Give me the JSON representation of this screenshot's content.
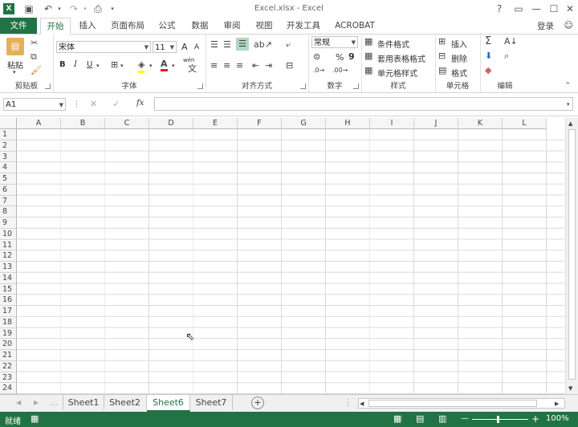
{
  "titlebar": {
    "title": "Excel.xlsx - Excel",
    "help": "?",
    "restore_ribbon": "▭",
    "minimize": "—",
    "maximize": "☐",
    "close": "✕"
  },
  "tabs": {
    "file": "文件",
    "items": [
      "开始",
      "插入",
      "页面布局",
      "公式",
      "数据",
      "审阅",
      "视图",
      "开发工具",
      "ACROBAT"
    ],
    "login": "登录"
  },
  "ribbon": {
    "clipboard": {
      "paste": "粘贴",
      "label": "剪贴板"
    },
    "font": {
      "name": "宋体",
      "size": "11",
      "bold": "B",
      "italic": "I",
      "underline": "U",
      "grow": "A",
      "shrink": "A",
      "label": "字体",
      "wen": "wén"
    },
    "alignment": {
      "label": "对齐方式"
    },
    "number": {
      "format": "常规",
      "percent": "%",
      "comma": "9",
      "label": "数字"
    },
    "styles": {
      "conditional": "条件格式",
      "table": "套用表格格式",
      "cell": "单元格样式",
      "label": "样式"
    },
    "cells": {
      "insert": "插入",
      "delete": "删除",
      "format": "格式",
      "label": "单元格"
    },
    "editing": {
      "label": "编辑"
    }
  },
  "formula_bar": {
    "name_box": "A1",
    "fx": "fx",
    "value": ""
  },
  "grid": {
    "columns": [
      "A",
      "B",
      "C",
      "D",
      "E",
      "F",
      "G",
      "H",
      "I",
      "J",
      "K",
      "L"
    ],
    "rows": [
      "1",
      "2",
      "3",
      "4",
      "5",
      "6",
      "7",
      "8",
      "9",
      "10",
      "11",
      "12",
      "13",
      "14",
      "15",
      "16",
      "17",
      "18",
      "19",
      "20",
      "21",
      "22",
      "23",
      "24"
    ]
  },
  "sheets": {
    "items": [
      "Sheet1",
      "Sheet2",
      "Sheet6",
      "Sheet7"
    ],
    "active": "Sheet6"
  },
  "status": {
    "ready": "就绪",
    "zoom": "100%",
    "minus": "—",
    "plus": "+"
  },
  "colors": {
    "accent": "#217346"
  }
}
